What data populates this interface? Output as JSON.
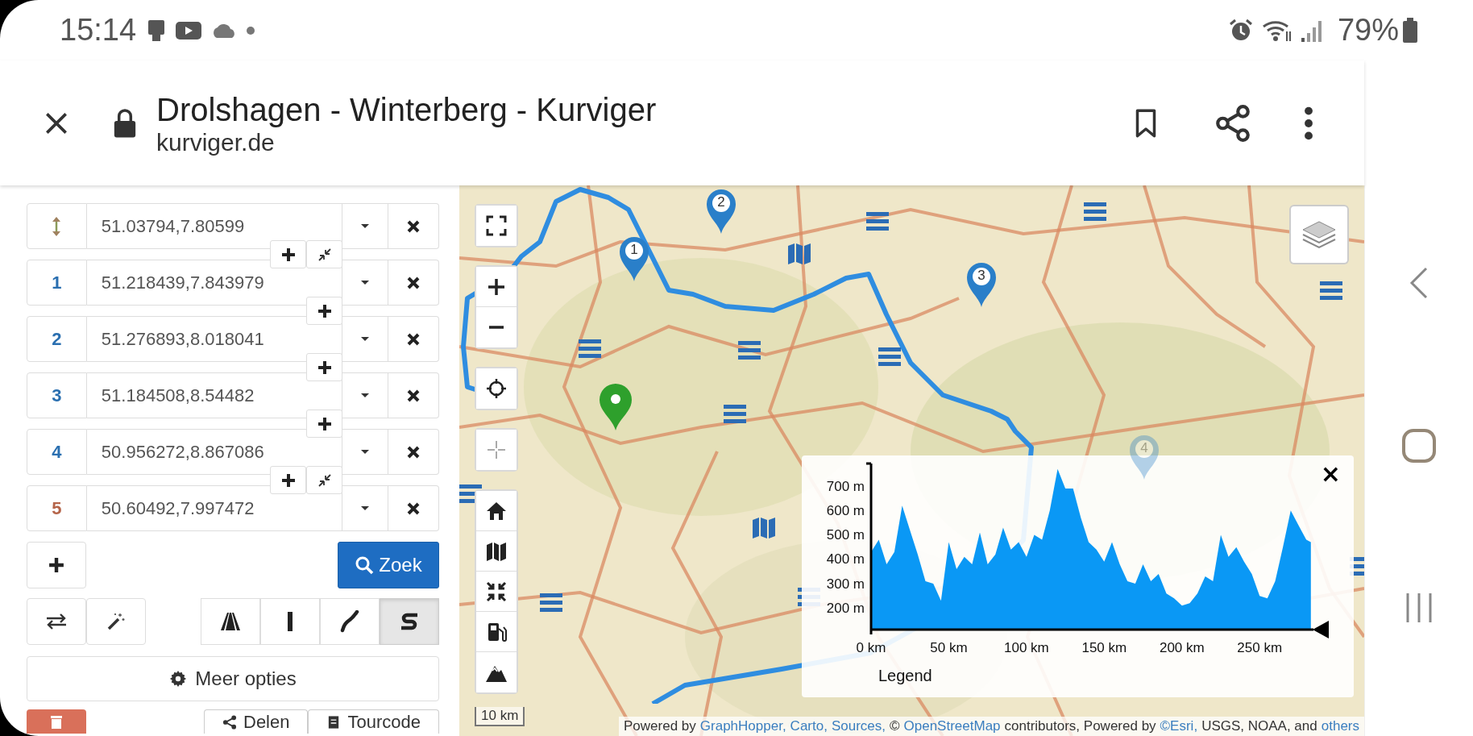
{
  "status_bar": {
    "time": "15:14",
    "battery": "79%"
  },
  "browser": {
    "title": "Drolshagen - Winterberg - Kurviger",
    "url": "kurviger.de"
  },
  "waypoints": [
    {
      "kind": "start",
      "value": "51.03794,7.80599",
      "join": {
        "merge": true
      }
    },
    {
      "kind": "via",
      "label": "1",
      "color": "#2a6fb0",
      "value": "51.218439,7.843979",
      "join": {
        "merge": false
      }
    },
    {
      "kind": "via",
      "label": "2",
      "color": "#2a6fb0",
      "value": "51.276893,8.018041",
      "join": {
        "merge": false
      }
    },
    {
      "kind": "via",
      "label": "3",
      "color": "#2a6fb0",
      "value": "51.184508,8.54482",
      "join": {
        "merge": false
      }
    },
    {
      "kind": "via",
      "label": "4",
      "color": "#2a6fb0",
      "value": "50.956272,8.867086",
      "join": {
        "merge": true
      }
    },
    {
      "kind": "via",
      "label": "5",
      "color": "#b5654a",
      "value": "50.60492,7.997472"
    }
  ],
  "search_button": "Zoek",
  "route_types": [
    {
      "kind": "highway",
      "selected": false
    },
    {
      "kind": "straight",
      "selected": false
    },
    {
      "kind": "curvy",
      "selected": false
    },
    {
      "kind": "extra-curvy",
      "selected": true
    }
  ],
  "more_options": "Meer opties",
  "bottom_buttons": [
    "Delen",
    "Tourcode"
  ],
  "map": {
    "markers": [
      {
        "label": "1",
        "dimmed": false
      },
      {
        "label": "2",
        "dimmed": false
      },
      {
        "label": "3",
        "dimmed": false
      },
      {
        "label": "4",
        "dimmed": true
      }
    ],
    "scale": "10 km",
    "attribution": [
      {
        "kind": "text",
        "text": "Powered by"
      },
      {
        "kind": "link",
        "text": "GraphHopper,"
      },
      {
        "kind": "link",
        "text": "Carto,"
      },
      {
        "kind": "link",
        "text": "Sources,"
      },
      {
        "kind": "text",
        "text": "©"
      },
      {
        "kind": "link",
        "text": "OpenStreetMap"
      },
      {
        "kind": "text",
        "text": "contributors, Powered by"
      },
      {
        "kind": "link",
        "text": "©Esri,"
      },
      {
        "kind": "text",
        "text": "USGS, NOAA, and"
      },
      {
        "kind": "link",
        "text": "others"
      }
    ]
  },
  "elevation": {
    "legend": "Legend",
    "close": "×",
    "chart_data": {
      "type": "area",
      "ylim": [
        112,
        776
      ],
      "xlim": [
        0,
        283.6
      ],
      "xticks": [
        {
          "value": 0,
          "label": "0 km"
        },
        {
          "value": 50,
          "label": "50 km"
        },
        {
          "value": 100,
          "label": "100 km"
        },
        {
          "value": 150,
          "label": "150 km"
        },
        {
          "value": 200,
          "label": "200 km"
        },
        {
          "value": 250,
          "label": "250 km"
        }
      ],
      "yticks": [
        {
          "value": 200,
          "label": "200 m"
        },
        {
          "value": 300,
          "label": "300 m"
        },
        {
          "value": 400,
          "label": "400 m"
        },
        {
          "value": 500,
          "label": "500 m"
        },
        {
          "value": 600,
          "label": "600 m"
        },
        {
          "value": 700,
          "label": "700 m"
        }
      ],
      "x": [
        0,
        5,
        10,
        15,
        20,
        25,
        30,
        35,
        40,
        45,
        50,
        55,
        60,
        65,
        70,
        75,
        80,
        85,
        90,
        95,
        100,
        105,
        110,
        115,
        120,
        125,
        130,
        135,
        140,
        145,
        150,
        155,
        160,
        165,
        170,
        175,
        180,
        185,
        190,
        195,
        200,
        205,
        210,
        215,
        220,
        225,
        230,
        235,
        240,
        245,
        250,
        255,
        260,
        265,
        270,
        275,
        280,
        283
      ],
      "values": [
        430,
        480,
        380,
        430,
        620,
        520,
        420,
        310,
        300,
        230,
        470,
        360,
        410,
        380,
        510,
        380,
        420,
        530,
        440,
        470,
        410,
        500,
        480,
        600,
        770,
        690,
        690,
        570,
        470,
        440,
        390,
        470,
        380,
        310,
        300,
        380,
        310,
        340,
        260,
        240,
        210,
        220,
        260,
        330,
        310,
        500,
        410,
        450,
        390,
        340,
        250,
        240,
        310,
        450,
        600,
        540,
        480,
        470
      ]
    }
  }
}
